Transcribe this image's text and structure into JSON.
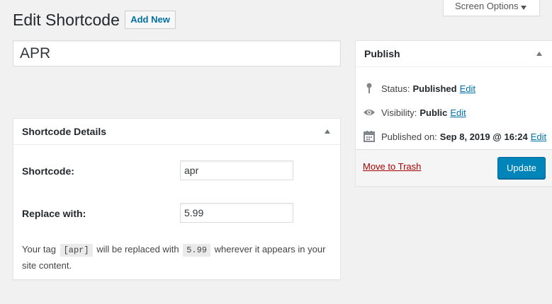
{
  "header": {
    "title": "Edit Shortcode",
    "add_new_label": "Add New",
    "screen_options_label": "Screen Options"
  },
  "post_title": {
    "value": "APR"
  },
  "shortcode_details": {
    "heading": "Shortcode Details",
    "shortcode_label": "Shortcode:",
    "shortcode_value": "apr",
    "replace_label": "Replace with:",
    "replace_value": "5.99",
    "help_prefix": "Your tag",
    "help_tag": "[apr]",
    "help_middle": "will be replaced with",
    "help_value": "5.99",
    "help_suffix": "wherever it appears in your site content."
  },
  "publish": {
    "heading": "Publish",
    "status_label": "Status:",
    "status_value": "Published",
    "visibility_label": "Visibility:",
    "visibility_value": "Public",
    "published_on_label": "Published on:",
    "published_on_value": "Sep 8, 2019 @ 16:24",
    "edit_label": "Edit",
    "trash_label": "Move to Trash",
    "update_label": "Update"
  },
  "colors": {
    "primary_button": "#0085ba",
    "link": "#0073aa",
    "trash": "#a00",
    "background": "#f1f1f1"
  },
  "icons": {
    "status": "pin-icon",
    "visibility": "eye-icon",
    "published_on": "calendar-icon",
    "collapse": "triangle-up-icon",
    "screen_options": "triangle-down-icon"
  }
}
